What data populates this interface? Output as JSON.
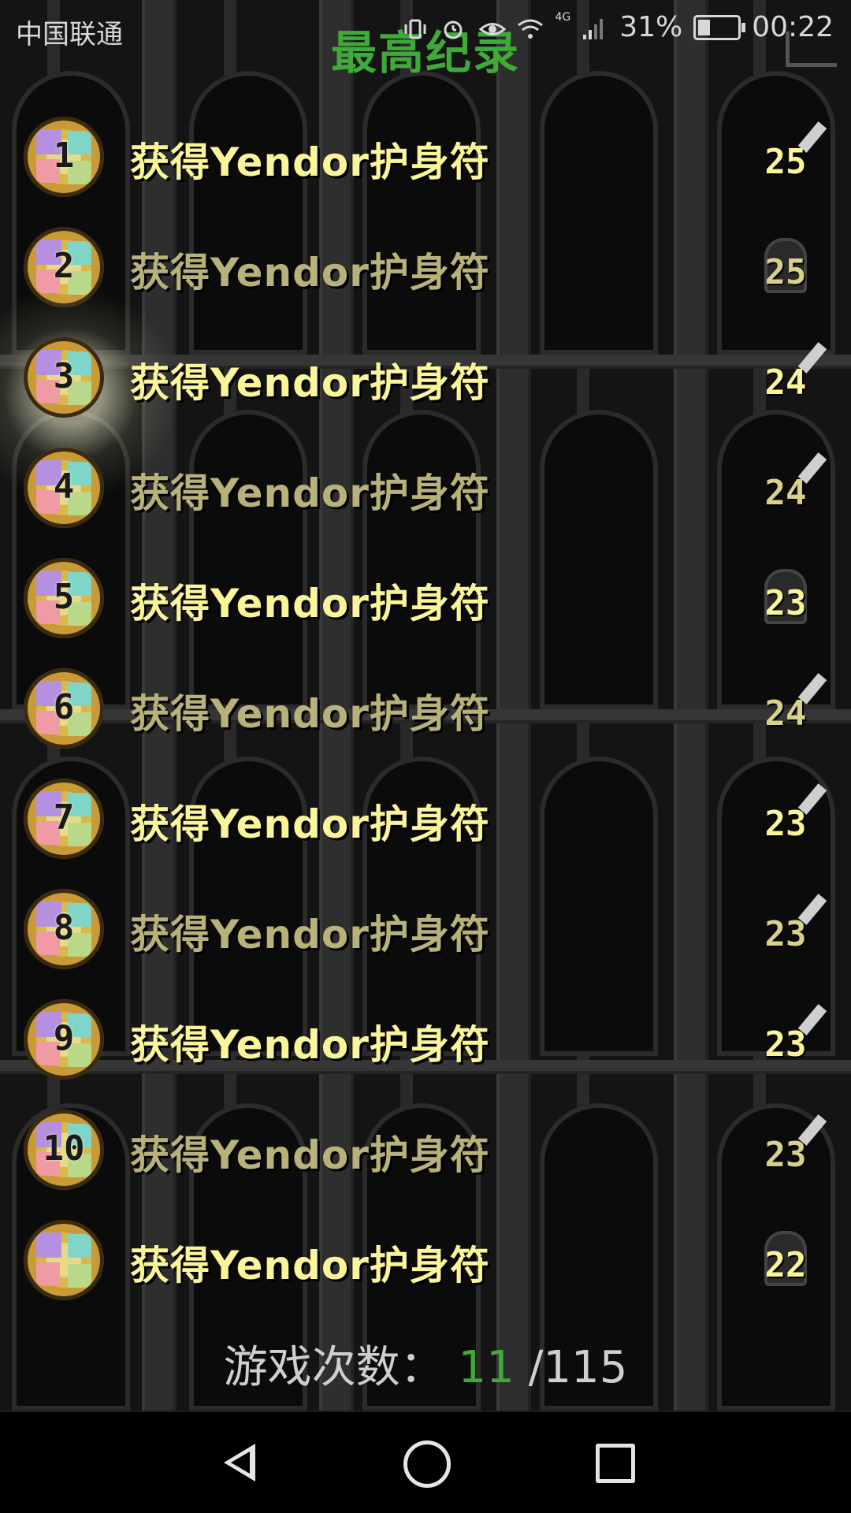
{
  "status_bar": {
    "carrier": "中国联通",
    "network": "4G",
    "battery": "31%",
    "battery_level": 0.31,
    "time": "00:22"
  },
  "header": {
    "title": "最高纪录"
  },
  "records": [
    {
      "rank": "1",
      "description": "获得Yendor护身符",
      "level": "25",
      "highlighted": true,
      "class_icon": "warrior-sword-icon"
    },
    {
      "rank": "2",
      "description": "获得Yendor护身符",
      "level": "25",
      "highlighted": false,
      "class_icon": "helmet-icon"
    },
    {
      "rank": "3",
      "description": "获得Yendor护身符",
      "level": "24",
      "highlighted": true,
      "class_icon": "rogue-dagger-icon"
    },
    {
      "rank": "4",
      "description": "获得Yendor护身符",
      "level": "24",
      "highlighted": false,
      "class_icon": "mage-staff-icon"
    },
    {
      "rank": "5",
      "description": "获得Yendor护身符",
      "level": "23",
      "highlighted": true,
      "class_icon": "helmet-icon"
    },
    {
      "rank": "6",
      "description": "获得Yendor护身符",
      "level": "24",
      "highlighted": false,
      "class_icon": "mage-staff-icon"
    },
    {
      "rank": "7",
      "description": "获得Yendor护身符",
      "level": "23",
      "highlighted": true,
      "class_icon": "mage-staff-icon"
    },
    {
      "rank": "8",
      "description": "获得Yendor护身符",
      "level": "23",
      "highlighted": false,
      "class_icon": "warrior-sword-icon"
    },
    {
      "rank": "9",
      "description": "获得Yendor护身符",
      "level": "23",
      "highlighted": true,
      "class_icon": "rogue-dagger-icon"
    },
    {
      "rank": "10",
      "description": "获得Yendor护身符",
      "level": "23",
      "highlighted": false,
      "class_icon": "rogue-dagger-icon"
    },
    {
      "rank": "",
      "description": "获得Yendor护身符",
      "level": "22",
      "highlighted": true,
      "class_icon": "helmet-icon"
    }
  ],
  "footer": {
    "games_label": "游戏次数：",
    "games_current": "11",
    "games_total": "/115"
  },
  "nav": {
    "back_icon": "back-triangle-icon",
    "home_icon": "home-circle-icon",
    "recent_icon": "recent-square-icon"
  }
}
